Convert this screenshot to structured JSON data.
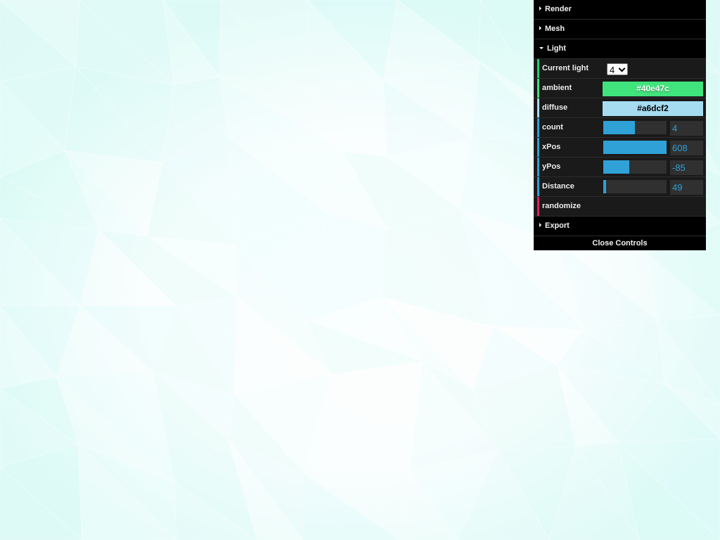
{
  "colors": {
    "background_tint_a": "#d8fbe9",
    "background_tint_b": "#dffbfd",
    "folder_bg": "#000000",
    "row_bg": "#1a1a1a",
    "number_accent": "#2fa1d6",
    "color_stripe": "#40e47c",
    "function_stripe": "#e61d5f"
  },
  "panel": {
    "folders": {
      "render": "Render",
      "mesh": "Mesh",
      "light": "Light",
      "export": "Export"
    },
    "light": {
      "current_light": {
        "label": "Current light",
        "value": "4"
      },
      "ambient": {
        "label": "ambient",
        "value": "#40e47c",
        "color": "#40e47c",
        "text_color": "#ffffff"
      },
      "diffuse": {
        "label": "diffuse",
        "value": "#a6dcf2",
        "color": "#a6dcf2",
        "text_color": "#000000"
      },
      "count": {
        "label": "count",
        "value": "4",
        "fraction": 0.5
      },
      "xpos": {
        "label": "xPos",
        "value": "608",
        "fraction": 1.0
      },
      "ypos": {
        "label": "yPos",
        "value": "-85",
        "fraction": 0.41
      },
      "distance": {
        "label": "Distance",
        "value": "49",
        "fraction": 0.04
      },
      "randomize": {
        "label": "randomize"
      }
    },
    "close_label": "Close Controls"
  }
}
